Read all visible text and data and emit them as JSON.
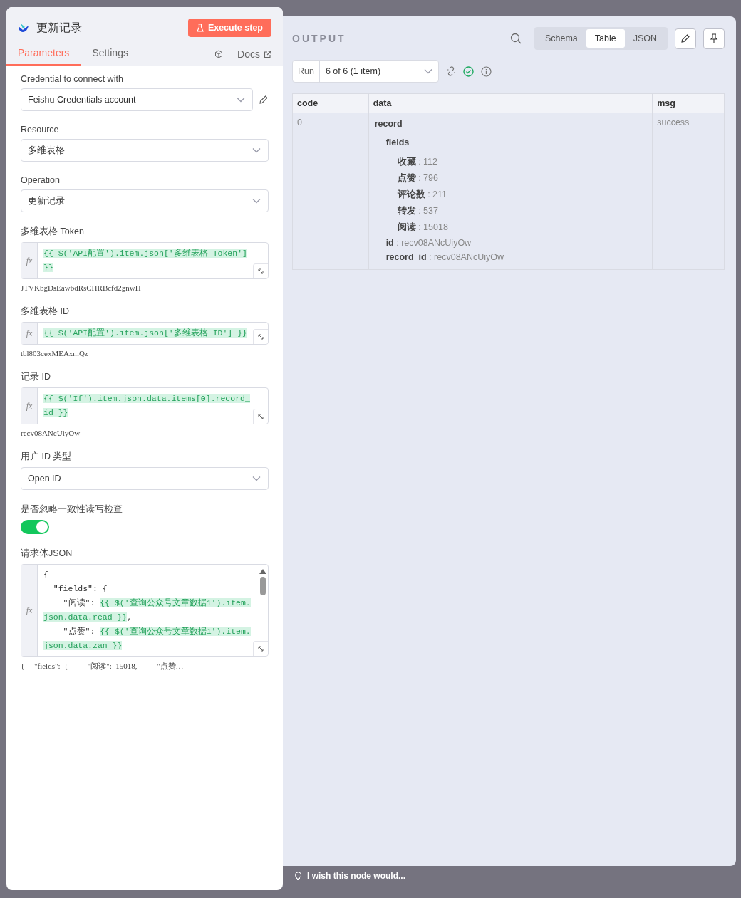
{
  "node_panel": {
    "title": "更新记录",
    "execute_button": "Execute step",
    "tabs": [
      {
        "label": "Parameters",
        "selected": true
      },
      {
        "label": "Settings",
        "selected": false
      }
    ],
    "docs_link": "Docs",
    "parameters": [
      {
        "kind": "select",
        "label": "Credential to connect with",
        "value": "Feishu Credentials account",
        "editable": true
      },
      {
        "kind": "select",
        "label": "Resource",
        "value": "多维表格",
        "editable": false
      },
      {
        "kind": "select",
        "label": "Operation",
        "value": "更新记录",
        "editable": false
      },
      {
        "kind": "expression",
        "prefix": "fx",
        "label": "多维表格 Token",
        "expression": "{{ $('API配置').item.json['多维表格 Token'] }}",
        "hint": "JTVKbgDsEawbdRsCHRBcfd2gnwH"
      },
      {
        "kind": "expression",
        "prefix": "fx",
        "label": "多维表格 ID",
        "expression": "{{ $('API配置').item.json['多维表格 ID'] }}",
        "hint": "tbl803cexMEAxmQz"
      },
      {
        "kind": "expression",
        "prefix": "fx",
        "label": "记录 ID",
        "expression": "{{ $('If').item.json.data.items[0].record_id }}",
        "hint": "recv08ANcUiyOw"
      },
      {
        "kind": "select",
        "label": "用户 ID 类型",
        "value": "Open ID",
        "editable": false
      },
      {
        "kind": "toggle",
        "label": "是否忽略一致性读写检查",
        "on": true
      },
      {
        "kind": "code",
        "prefix": "fx",
        "label": "请求体JSON",
        "lines": [
          [
            {
              "kind": "plain",
              "text": "{"
            }
          ],
          [
            {
              "kind": "plain",
              "text": "  \"fields\": {"
            }
          ],
          [
            {
              "kind": "plain",
              "text": "    \"阅读\": "
            },
            {
              "kind": "expr",
              "text": "{{ $('查询公众号文章数据1').item.json.data.read }}"
            },
            {
              "kind": "plain",
              "text": ","
            }
          ],
          [
            {
              "kind": "plain",
              "text": "    \"点赞\": "
            },
            {
              "kind": "expr",
              "text": "{{ $('查询公众号文章数据1').item.json.data.zan }}"
            }
          ]
        ],
        "hint": "{     \"fields\":  {          \"阅读\":  15018,          \"点赞…"
      }
    ]
  },
  "output_panel": {
    "title": "OUTPUT",
    "view_tabs": [
      {
        "label": "Schema",
        "selected": false
      },
      {
        "label": "Table",
        "selected": true
      },
      {
        "label": "JSON",
        "selected": false
      }
    ],
    "run_selector": {
      "label": "Run",
      "value": "6 of 6 (1 item)"
    },
    "table": {
      "separator": ":",
      "columns": [
        "code",
        "data",
        "msg"
      ],
      "rows": [
        {
          "code": "0",
          "msg": "success",
          "data": [
            {
              "key": "record",
              "children": [
                {
                  "key": "fields",
                  "children": [
                    {
                      "key": "收藏",
                      "value": "112"
                    },
                    {
                      "key": "点赞",
                      "value": "796"
                    },
                    {
                      "key": "评论数",
                      "value": "211"
                    },
                    {
                      "key": "转发",
                      "value": "537"
                    },
                    {
                      "key": "阅读",
                      "value": "15018"
                    }
                  ]
                },
                {
                  "key": "id",
                  "value": "recv08ANcUiyOw"
                },
                {
                  "key": "record_id",
                  "value": "recv08ANcUiyOw"
                }
              ]
            }
          ]
        }
      ]
    }
  },
  "feedback": {
    "text": "I wish this node would..."
  }
}
